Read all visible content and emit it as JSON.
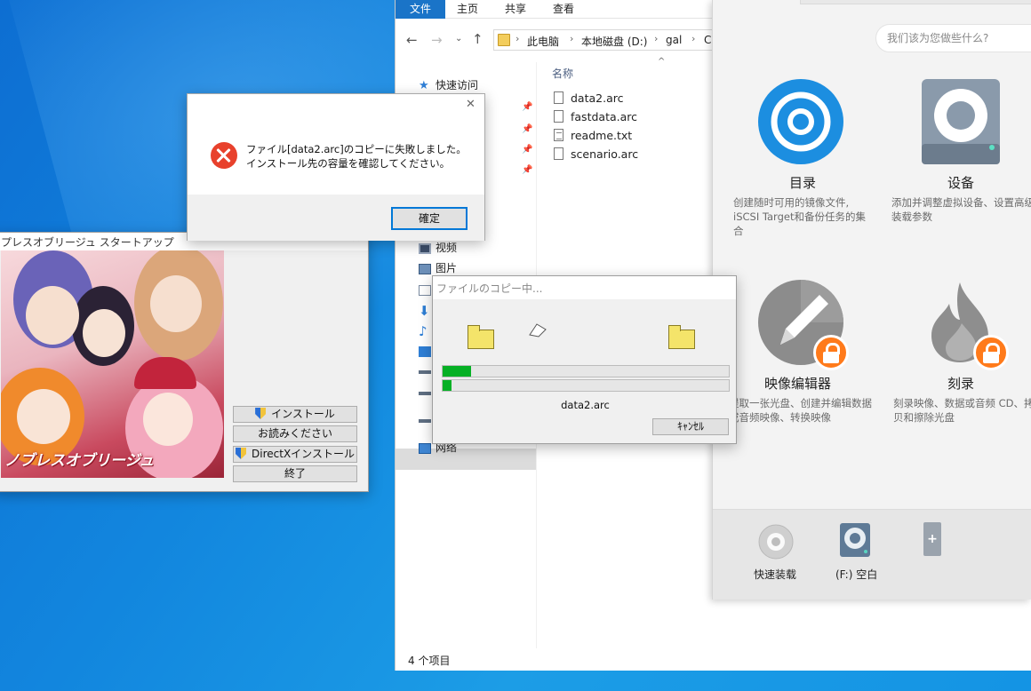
{
  "explorer": {
    "tabs": [
      "文件",
      "主页",
      "共享",
      "查看"
    ],
    "breadcrumb": [
      "此电脑",
      "本地磁盘 (D:)",
      "gal",
      "C"
    ],
    "nav": {
      "quick_access": "快速访问",
      "videos": "视频",
      "pictures": "图片",
      "network": "网络"
    },
    "column_header": "名称",
    "files": [
      "data2.arc",
      "fastdata.arc",
      "readme.txt",
      "scenario.arc"
    ],
    "status": "4 个项目"
  },
  "disc_app": {
    "search_placeholder": "我们该为您做些什么?",
    "features": [
      {
        "title": "目录",
        "desc": "创建随时可用的镜像文件, iSCSI Target和备份任务的集合"
      },
      {
        "title": "设备",
        "desc": "添加并调整虚拟设备、设置高级装载参数"
      },
      {
        "title": "映像编辑器",
        "desc": "提取一张光盘、创建并编辑数据或音频映像、转换映像"
      },
      {
        "title": "刻录",
        "desc": "刻录映像、数据或音频 CD、拷贝和擦除光盘"
      }
    ],
    "bottom": [
      {
        "label": "快速装载"
      },
      {
        "label": "(F:) 空白"
      },
      {
        "label": "+"
      }
    ]
  },
  "error_dialog": {
    "line1": "ファイル[data2.arc]のコピーに失敗しました。",
    "line2": "インストール先の容量を確認してください。",
    "ok": "確定",
    "close": "✕"
  },
  "startup": {
    "title": "プレスオブリージュ スタートアップ",
    "logo_text": "ノブレスオブリージュ",
    "buttons": {
      "install": "インストール",
      "readme": "お読みください",
      "directx": "DirectXインストール",
      "exit": "終了"
    }
  },
  "copy_dialog": {
    "title": "ファイルのコピー中...",
    "filename": "data2.arc",
    "cancel": "ｷｬﾝｾﾙ",
    "progress_overall": 0.1,
    "progress_file": 0.03
  },
  "colors": {
    "accent": "#1a74c8",
    "progress": "#06b025",
    "error": "#e8412c",
    "lock": "#ff7a1a"
  }
}
